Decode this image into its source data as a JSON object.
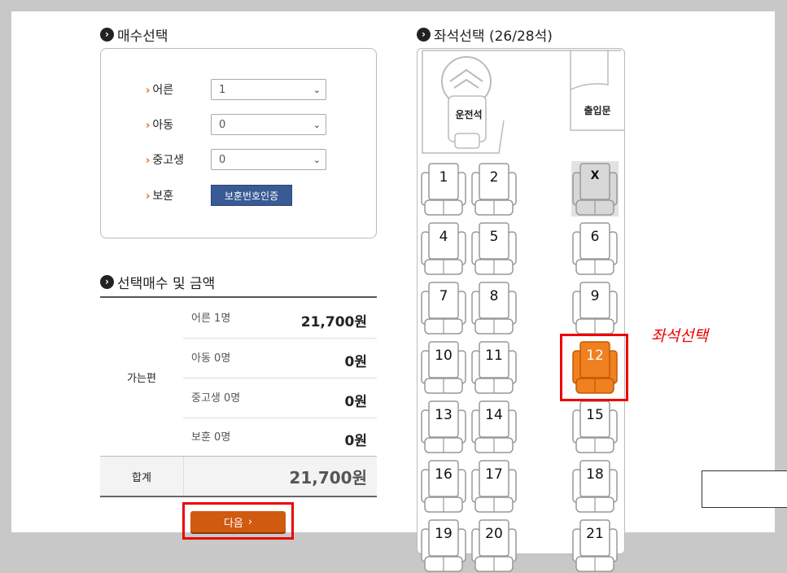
{
  "ticket_section": {
    "title": "매수선택",
    "rows": [
      {
        "label": "어른",
        "value": "1"
      },
      {
        "label": "아동",
        "value": "0"
      },
      {
        "label": "중고생",
        "value": "0"
      },
      {
        "label": "보훈",
        "button": "보훈번호인증"
      }
    ]
  },
  "seat_section": {
    "title": "좌석선택 (26/28석)"
  },
  "summary": {
    "title": "선택매수 및 금액",
    "direction": "가는편",
    "lines": [
      {
        "name": "어른 1명",
        "amount": "21,700원"
      },
      {
        "name": "아동 0명",
        "amount": "0원"
      },
      {
        "name": "중고생 0명",
        "amount": "0원"
      },
      {
        "name": "보훈 0명",
        "amount": "0원"
      }
    ],
    "total_label": "합계",
    "total_amount": "21,700원"
  },
  "next_button": "다음",
  "bus": {
    "driver": "운전석",
    "entrance": "출입문",
    "seats": [
      "1",
      "2",
      "X",
      "4",
      "5",
      "6",
      "7",
      "8",
      "9",
      "10",
      "11",
      "12",
      "13",
      "14",
      "15",
      "16",
      "17",
      "18",
      "19",
      "20",
      "21"
    ],
    "selected_seat": "12",
    "unavailable_seat": "X"
  },
  "annotation": "좌석선택",
  "colors": {
    "accent": "#d05a10",
    "selected_seat": "#f08020",
    "auth_button": "#3a5a95",
    "highlight": "#ee0000"
  }
}
